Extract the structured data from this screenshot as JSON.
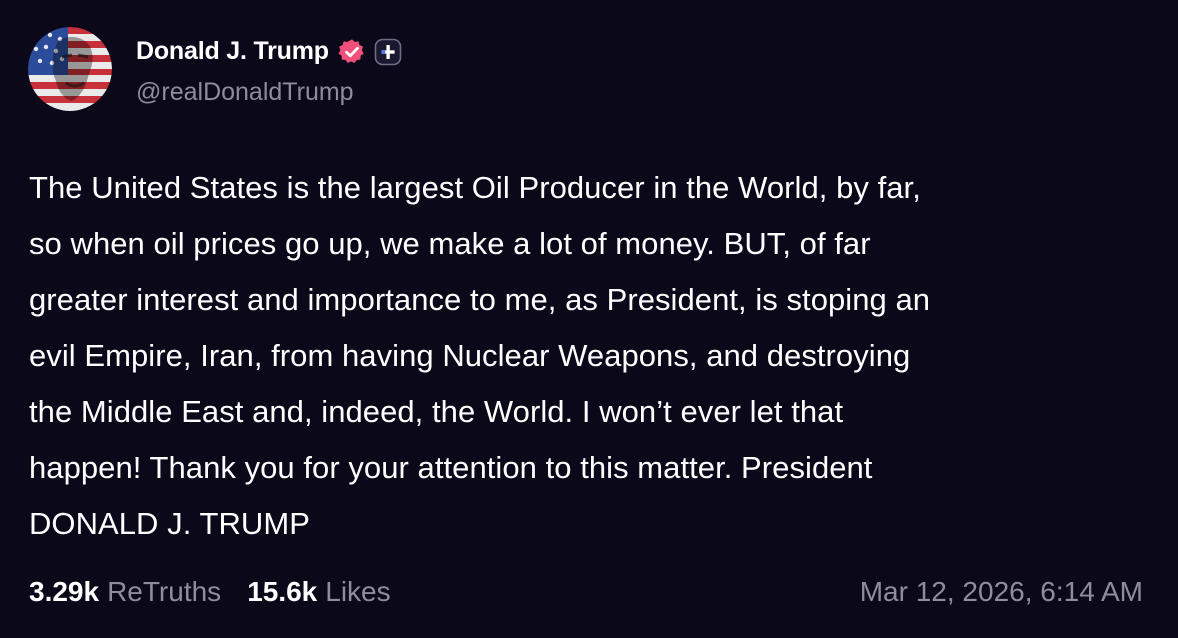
{
  "author": {
    "display_name": "Donald J. Trump",
    "handle": "@realDonaldTrump",
    "avatar_icon": "flag-portrait-avatar",
    "verified_icon": "verified-badge-icon",
    "plus_icon": "plus-badge-icon"
  },
  "post": {
    "text": "The United States is the largest Oil Producer in the World, by far,\nso when oil prices go up, we make a lot of money. BUT, of far\ngreater interest and importance to me, as President, is stoping an\nevil Empire, Iran, from having Nuclear Weapons, and destroying\nthe Middle East and, indeed, the World. I won’t ever let that\nhappen! Thank you for your attention to this matter. President\nDONALD J. TRUMP"
  },
  "stats": {
    "retruths_count": "3.29k",
    "retruths_label": "ReTruths",
    "likes_count": "15.6k",
    "likes_label": "Likes"
  },
  "timestamp": "Mar 12, 2026, 6:14 AM",
  "colors": {
    "background": "#0b0819",
    "text": "#ffffff",
    "muted": "#8f8c9e",
    "verified": "#f0507a"
  }
}
